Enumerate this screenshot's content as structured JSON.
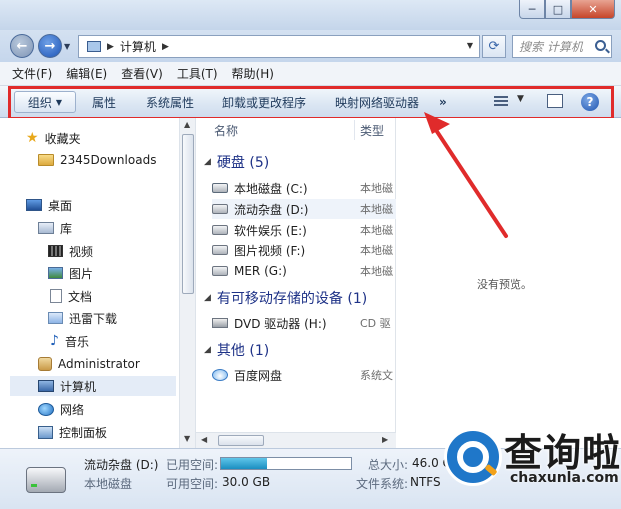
{
  "window": {
    "title": "计算机",
    "minimize": "─",
    "maximize": "□",
    "close": "✕"
  },
  "nav": {
    "back_icon": "arrow-left-icon",
    "forward_icon": "arrow-right-icon",
    "address": "计算机",
    "search_placeholder": "搜索 计算机"
  },
  "menu": [
    "文件(F)",
    "编辑(E)",
    "查看(V)",
    "工具(T)",
    "帮助(H)"
  ],
  "toolbar": {
    "organize": "组织",
    "properties": "属性",
    "system_properties": "系统属性",
    "uninstall": "卸载或更改程序",
    "map_drive": "映射网络驱动器",
    "more": "»",
    "help": "?"
  },
  "sidebar": {
    "favorites": "收藏夹",
    "downloads": "2345Downloads",
    "desktop": "桌面",
    "libraries": "库",
    "videos": "视频",
    "pictures": "图片",
    "documents": "文档",
    "thunder": "迅雷下载",
    "music": "音乐",
    "admin": "Administrator",
    "computer": "计算机",
    "network": "网络",
    "control_panel": "控制面板"
  },
  "columns": {
    "name": "名称",
    "type": "类型"
  },
  "groups": {
    "hdd": "硬盘 (5)",
    "removable": "有可移动存储的设备 (1)",
    "other": "其他 (1)"
  },
  "drives": [
    {
      "name": "本地磁盘 (C:)",
      "type": "本地磁"
    },
    {
      "name": "流动杂盘 (D:)",
      "type": "本地磁"
    },
    {
      "name": "软件娱乐 (E:)",
      "type": "本地磁"
    },
    {
      "name": "图片视频 (F:)",
      "type": "本地磁"
    },
    {
      "name": "MER (G:)",
      "type": "本地磁"
    }
  ],
  "removable": [
    {
      "name": "DVD 驱动器 (H:)",
      "type": "CD 驱"
    }
  ],
  "other": [
    {
      "name": "百度网盘",
      "type": "系统文"
    }
  ],
  "preview": {
    "message": "没有预览。"
  },
  "status": {
    "drive_name": "流动杂盘 (D:)",
    "drive_type": "本地磁盘",
    "used_label": "已用空间:",
    "free_label": "可用空间:",
    "free_value": "30.0 GB",
    "total_label": "总大小:",
    "total_value": "46.0 G",
    "fs_label": "文件系统:",
    "fs_value": "NTFS",
    "used_fraction": 0.35
  },
  "watermark": {
    "cn": "查询啦",
    "en": "chaxunla.com"
  },
  "colors": {
    "highlight": "#e02b2b",
    "accent": "#1e3287"
  }
}
